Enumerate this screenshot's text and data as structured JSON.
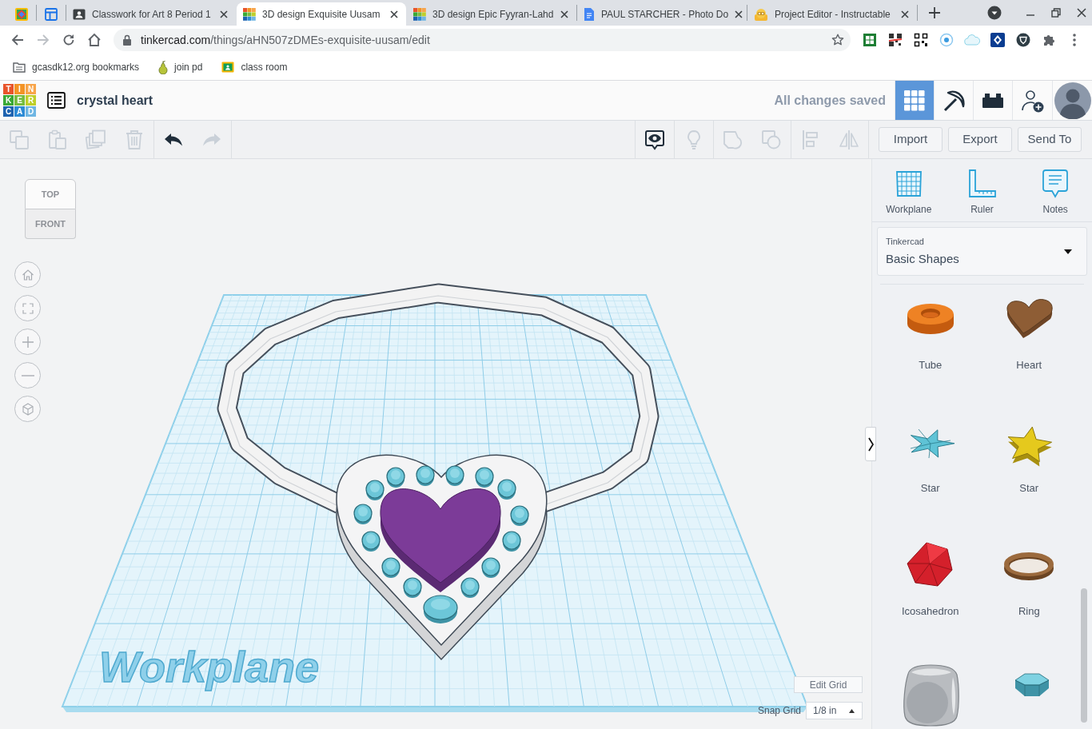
{
  "browser": {
    "tabs": [
      {
        "kind": "emblem",
        "pinned": true,
        "selected": false
      },
      {
        "kind": "layout",
        "pinned": true,
        "selected": false
      },
      {
        "kind": "classroom",
        "pinned": false,
        "title": "Classwork for Art 8 Period 1",
        "selected": false
      },
      {
        "kind": "tinkercad",
        "pinned": false,
        "title": "3D design Exquisite Uusam",
        "selected": true
      },
      {
        "kind": "tinkercad",
        "pinned": false,
        "title": "3D design Epic Fyyran-Lahd",
        "selected": false
      },
      {
        "kind": "docs",
        "pinned": false,
        "title": "PAUL STARCHER - Photo Do",
        "selected": false
      },
      {
        "kind": "instructables",
        "pinned": false,
        "title": "Project Editor - Instructable",
        "selected": false
      }
    ],
    "address": {
      "host": "tinkercad.com",
      "path": "/things/aHN507zDMEs-exquisite-uusam/edit"
    },
    "bookmarks": [
      {
        "kind": "folder",
        "label": "gcasdk12.org bookmarks"
      },
      {
        "kind": "pear",
        "label": "join pd"
      },
      {
        "kind": "classroom",
        "label": "class room"
      }
    ]
  },
  "app": {
    "logo": [
      [
        "T",
        "I",
        "N"
      ],
      [
        "K",
        "E",
        "R"
      ],
      [
        "C",
        "A",
        "D"
      ]
    ],
    "project_title": "crystal heart",
    "save_status": "All changes saved",
    "view_modes": [
      {
        "kind": "grid",
        "selected": true
      },
      {
        "kind": "pickaxe",
        "selected": false
      },
      {
        "kind": "bricks",
        "selected": false
      }
    ],
    "toolbar": {
      "edit_tools": [
        {
          "kind": "copy",
          "disabled": true
        },
        {
          "kind": "paste",
          "disabled": true
        },
        {
          "kind": "duplicate",
          "disabled": true
        },
        {
          "kind": "delete",
          "disabled": true
        }
      ],
      "history_tools": [
        {
          "kind": "undo",
          "disabled": false
        },
        {
          "kind": "redo",
          "disabled": true
        }
      ],
      "shape_tools": [
        {
          "kind": "notes_toggle",
          "disabled": false
        },
        {
          "kind": "bulb",
          "disabled": true
        },
        {
          "kind": "group",
          "disabled": true
        },
        {
          "kind": "hole",
          "disabled": true
        },
        {
          "kind": "align",
          "disabled": true
        },
        {
          "kind": "mirror",
          "disabled": true
        }
      ],
      "actions": [
        "Import",
        "Export",
        "Send To"
      ]
    },
    "view_cube": {
      "top": "TOP",
      "front": "FRONT"
    },
    "workplane_label": "Workplane",
    "grid": {
      "edit_button": "Edit Grid",
      "snap_label": "Snap Grid",
      "snap_value": "1/8 in"
    },
    "panel": {
      "tools": [
        {
          "kind": "workplane",
          "label": "Workplane"
        },
        {
          "kind": "ruler",
          "label": "Ruler"
        },
        {
          "kind": "notes",
          "label": "Notes"
        }
      ],
      "library": {
        "source": "Tinkercad",
        "name": "Basic Shapes"
      },
      "shapes": [
        {
          "kind": "tube",
          "label": "Tube"
        },
        {
          "kind": "heart",
          "label": "Heart"
        },
        {
          "kind": "star_flat",
          "label": "Star"
        },
        {
          "kind": "star",
          "label": "Star"
        },
        {
          "kind": "icosahedron",
          "label": "Icosahedron"
        },
        {
          "kind": "ring",
          "label": "Ring"
        },
        {
          "kind": "rounded_box"
        },
        {
          "kind": "gem"
        }
      ]
    }
  }
}
